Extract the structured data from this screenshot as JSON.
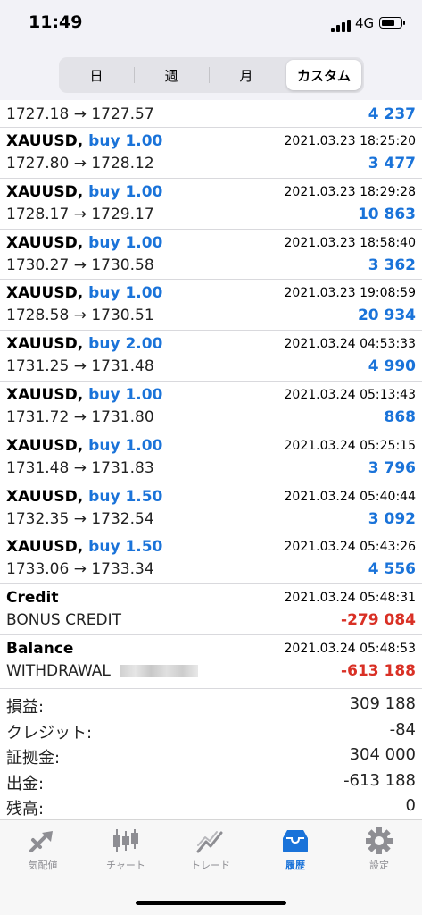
{
  "status": {
    "time": "11:49",
    "network": "4G"
  },
  "segments": [
    {
      "label": "日",
      "active": false
    },
    {
      "label": "週",
      "active": false
    },
    {
      "label": "月",
      "active": false
    },
    {
      "label": "カスタム",
      "active": true
    }
  ],
  "partial_row": {
    "prices": "1727.18 → 1727.57",
    "profit": "4 237"
  },
  "trades": [
    {
      "symbol": "XAUUSD,",
      "side": "buy 1.00",
      "datetime": "2021.03.23 18:25:20",
      "prices": "1727.80 → 1728.12",
      "profit": "3 477"
    },
    {
      "symbol": "XAUUSD,",
      "side": "buy 1.00",
      "datetime": "2021.03.23 18:29:28",
      "prices": "1728.17 → 1729.17",
      "profit": "10 863"
    },
    {
      "symbol": "XAUUSD,",
      "side": "buy 1.00",
      "datetime": "2021.03.23 18:58:40",
      "prices": "1730.27 → 1730.58",
      "profit": "3 362"
    },
    {
      "symbol": "XAUUSD,",
      "side": "buy 1.00",
      "datetime": "2021.03.23 19:08:59",
      "prices": "1728.58 → 1730.51",
      "profit": "20 934"
    },
    {
      "symbol": "XAUUSD,",
      "side": "buy 2.00",
      "datetime": "2021.03.24 04:53:33",
      "prices": "1731.25 → 1731.48",
      "profit": "4 990"
    },
    {
      "symbol": "XAUUSD,",
      "side": "buy 1.00",
      "datetime": "2021.03.24 05:13:43",
      "prices": "1731.72 → 1731.80",
      "profit": "868"
    },
    {
      "symbol": "XAUUSD,",
      "side": "buy 1.00",
      "datetime": "2021.03.24 05:25:15",
      "prices": "1731.48 → 1731.83",
      "profit": "3 796"
    },
    {
      "symbol": "XAUUSD,",
      "side": "buy 1.50",
      "datetime": "2021.03.24 05:40:44",
      "prices": "1732.35 → 1732.54",
      "profit": "3 092"
    },
    {
      "symbol": "XAUUSD,",
      "side": "buy 1.50",
      "datetime": "2021.03.24 05:43:26",
      "prices": "1733.06 → 1733.34",
      "profit": "4 556"
    }
  ],
  "ops": [
    {
      "type": "Credit",
      "datetime": "2021.03.24 05:48:31",
      "comment": "BONUS CREDIT",
      "amount": "-279 084"
    },
    {
      "type": "Balance",
      "datetime": "2021.03.24 05:48:53",
      "comment": "WITHDRAWAL",
      "amount": "-613 188"
    }
  ],
  "summary": [
    {
      "label": "損益:",
      "value": "309 188"
    },
    {
      "label": "クレジット:",
      "value": "-84"
    },
    {
      "label": "証拠金:",
      "value": "304 000"
    },
    {
      "label": "出金:",
      "value": "-613 188"
    },
    {
      "label": "残高:",
      "value": "0"
    }
  ],
  "tabs": [
    {
      "label": "気配値",
      "icon": "quotes-icon",
      "active": false
    },
    {
      "label": "チャート",
      "icon": "chart-icon",
      "active": false
    },
    {
      "label": "トレード",
      "icon": "trade-icon",
      "active": false
    },
    {
      "label": "履歴",
      "icon": "history-icon",
      "active": true
    },
    {
      "label": "設定",
      "icon": "settings-icon",
      "active": false
    }
  ],
  "colors": {
    "accent": "#1a73d9",
    "negative": "#d93025"
  }
}
